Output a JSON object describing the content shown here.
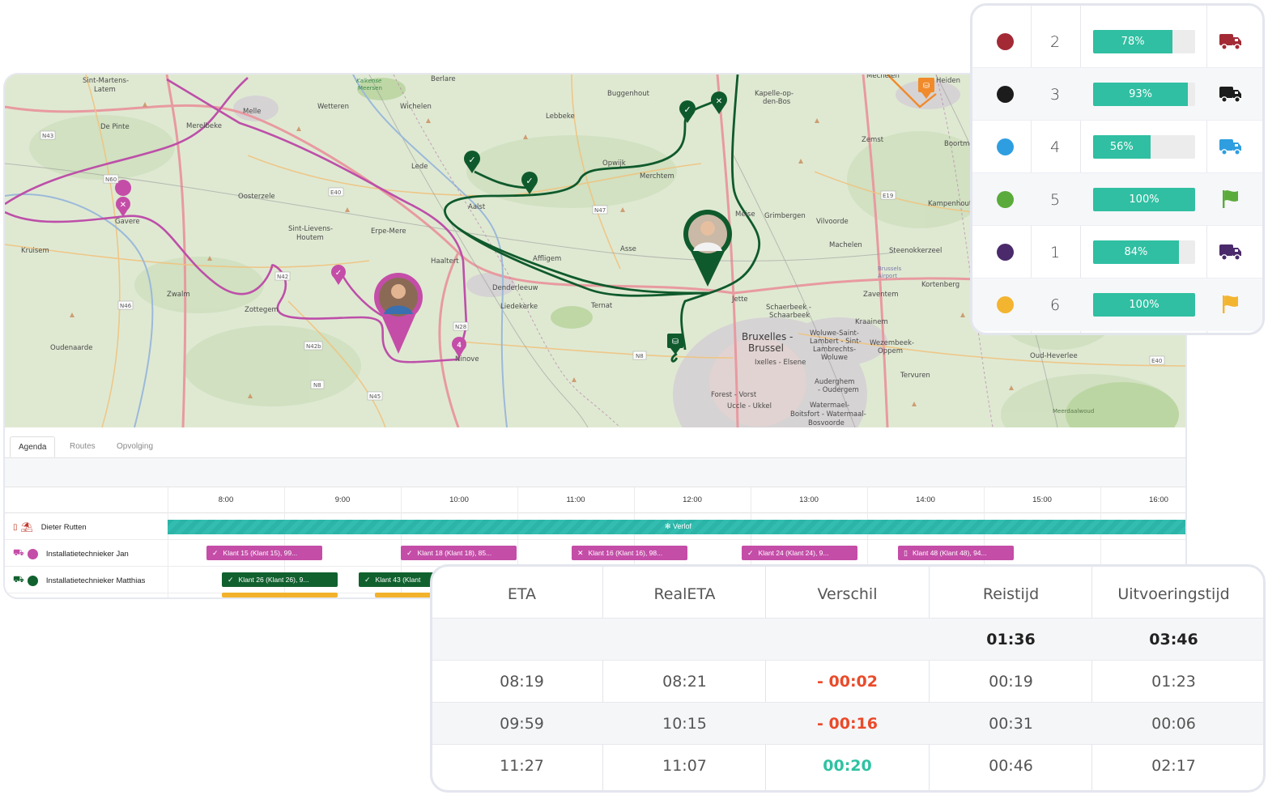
{
  "map": {
    "place_labels": [
      "Sint-Martens-Latem",
      "Berlare",
      "Kalkense Meersen",
      "Melle",
      "Wetteren",
      "Wichelen",
      "Buggenhout",
      "Kapelle-op-den-Bos",
      "Mechelen",
      "Heiden",
      "De Pinte",
      "Merelbeke",
      "Lebbeke",
      "Zemst",
      "Boortmeerbeek",
      "Lede",
      "Opwijk",
      "Merchtem",
      "Oosterzele",
      "Aalst",
      "Meise",
      "Grimbergen",
      "Vilvoorde",
      "Kampenhout",
      "Gavere",
      "Sint-Lievens-Houtem",
      "Erpe-Mere",
      "Affligem",
      "Asse",
      "Machelen",
      "Steenokkerzeel",
      "Kruisem",
      "Haaltert",
      "Zaventem",
      "Kortenberg",
      "Zwalm",
      "Zottegem",
      "Denderleeuw",
      "Liedekerke",
      "Ternat",
      "Jette",
      "Schaerbeek - Schaarbeek",
      "Kraainem",
      "Oudenaarde",
      "Ninove",
      "Bruxelles - Brussel",
      "Woluwe-Saint-Lambert - Sint-Lambrechts-Woluwe",
      "Wezembeek-Oppem",
      "Oud-Heverlee",
      "Ixelles - Elsene",
      "Tervuren",
      "Auderghem - Oudergem",
      "Forest - Vorst",
      "Uccle - Ukkel",
      "Watermael-Boitsfort - Watermaal-Bosvoorde",
      "Meerdaalwoud",
      "Brussels Airport"
    ],
    "road_labels": [
      "N43",
      "N60",
      "E40",
      "N47",
      "E19",
      "N42",
      "N46",
      "N42b",
      "N8",
      "N45",
      "N28",
      "E40",
      "N8"
    ]
  },
  "tabs": [
    {
      "label": "Agenda",
      "active": true
    },
    {
      "label": "Routes",
      "active": false
    },
    {
      "label": "Opvolging",
      "active": false
    }
  ],
  "schedule": {
    "hours": [
      "8:00",
      "9:00",
      "10:00",
      "11:00",
      "12:00",
      "13:00",
      "14:00",
      "15:00",
      "16:00"
    ],
    "resources": [
      {
        "name": "Dieter Rutten",
        "color": "#c0392b"
      },
      {
        "name": "Installatietechnieker Jan",
        "color": "#c44da8"
      },
      {
        "name": "Installatietechnieker Matthias",
        "color": "#11612f"
      }
    ],
    "verlof_label": "Verlof",
    "events_jan": [
      {
        "label": "Klant 15 (Klant 15), 99...",
        "icon": "check"
      },
      {
        "label": "Klant 18 (Klant 18), 85...",
        "icon": "check"
      },
      {
        "label": "Klant 16 (Klant 16), 98...",
        "icon": "cross"
      },
      {
        "label": "Klant 24 (Klant 24), 9...",
        "icon": "check"
      },
      {
        "label": "Klant 48 (Klant 48), 94...",
        "icon": "phone"
      }
    ],
    "events_matthias": [
      {
        "label": "Klant 26 (Klant 26), 9...",
        "icon": "check"
      },
      {
        "label": "Klant 43 (Klant",
        "icon": "check"
      }
    ]
  },
  "legend": {
    "rows": [
      {
        "color": "#a32a35",
        "number": "2",
        "percent": 78,
        "percent_label": "78%",
        "icon": "truck-icon"
      },
      {
        "color": "#1c1c1c",
        "number": "3",
        "percent": 93,
        "percent_label": "93%",
        "icon": "truck-icon"
      },
      {
        "color": "#2f9ee0",
        "number": "4",
        "percent": 56,
        "percent_label": "56%",
        "icon": "truck-icon"
      },
      {
        "color": "#5aab3b",
        "number": "5",
        "percent": 100,
        "percent_label": "100%",
        "icon": "flag-icon"
      },
      {
        "color": "#4a2a6b",
        "number": "1",
        "percent": 84,
        "percent_label": "84%",
        "icon": "truck-icon"
      },
      {
        "color": "#f3b430",
        "number": "6",
        "percent": 100,
        "percent_label": "100%",
        "icon": "flag-icon"
      }
    ]
  },
  "time_table": {
    "headers": [
      "ETA",
      "RealETA",
      "Verschil",
      "Reistijd",
      "Uitvoeringstijd"
    ],
    "totals": [
      "",
      "",
      "",
      "01:36",
      "03:46"
    ],
    "rows": [
      [
        "08:19",
        "08:21",
        "- 00:02",
        "00:19",
        "01:23"
      ],
      [
        "09:59",
        "10:15",
        "- 00:16",
        "00:31",
        "00:06"
      ],
      [
        "11:27",
        "11:07",
        "00:20",
        "00:46",
        "02:17"
      ]
    ]
  }
}
